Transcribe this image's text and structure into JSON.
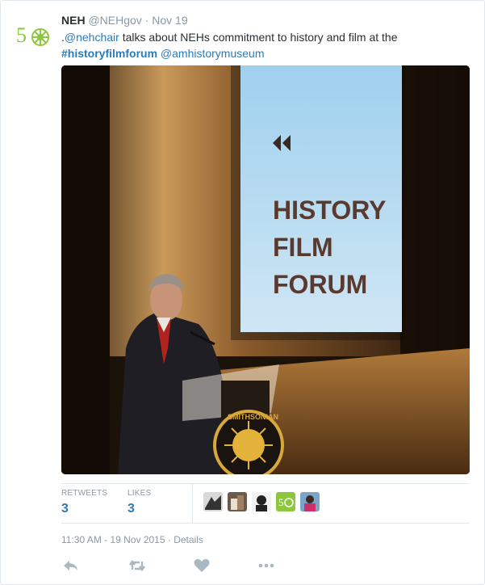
{
  "tweet": {
    "author_name": "NEH",
    "author_handle": "@NEHgov",
    "separator": "·",
    "date": "Nov 19",
    "text_prefix": ".",
    "mention_1": "@nehchair",
    "text_middle": " talks about NEHs commitment to history and film at the",
    "hashtag": "#historyfilmforum",
    "mention_2": "@amhistorymuseum"
  },
  "photo": {
    "screen_lines": [
      "HISTORY",
      "FILM",
      "FORUM"
    ],
    "seal_text": "SMITHSONIAN"
  },
  "stats": {
    "retweets_label": "RETWEETS",
    "retweets_count": "3",
    "likes_label": "LIKES",
    "likes_count": "3"
  },
  "timestamp": "11:30 AM - 19 Nov 2015",
  "details_link": "Details",
  "actions": {
    "icons": [
      "reply-icon",
      "retweet-icon",
      "like-icon",
      "more-icon"
    ]
  },
  "colors": {
    "link": "#2b7bb9",
    "muted": "#8899a6",
    "text": "#292f33",
    "neh_green": "#8dc63f"
  }
}
